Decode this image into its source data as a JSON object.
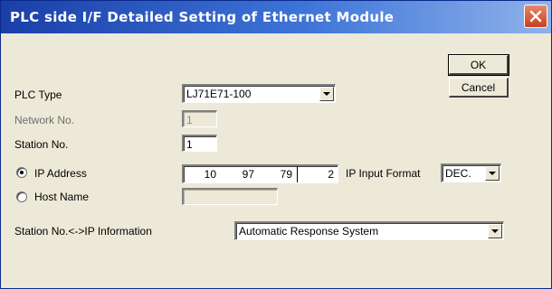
{
  "window": {
    "title": "PLC side I/F Detailed Setting of Ethernet Module"
  },
  "buttons": {
    "ok": "OK",
    "cancel": "Cancel"
  },
  "plc_type": {
    "label": "PLC Type",
    "value": "LJ71E71-100"
  },
  "network_no": {
    "label": "Network No.",
    "value": "1"
  },
  "station_no": {
    "label": "Station No.",
    "value": "1"
  },
  "ip_address": {
    "label": "IP Address",
    "selected": true,
    "octets": [
      "10",
      "97",
      "79",
      "2"
    ],
    "input_format_label": "IP Input Format",
    "input_format_value": "DEC."
  },
  "host_name": {
    "label": "Host Name",
    "selected": false,
    "value": ""
  },
  "station_ip_info": {
    "label": "Station No.<->IP Information",
    "value": "Automatic Response System"
  }
}
